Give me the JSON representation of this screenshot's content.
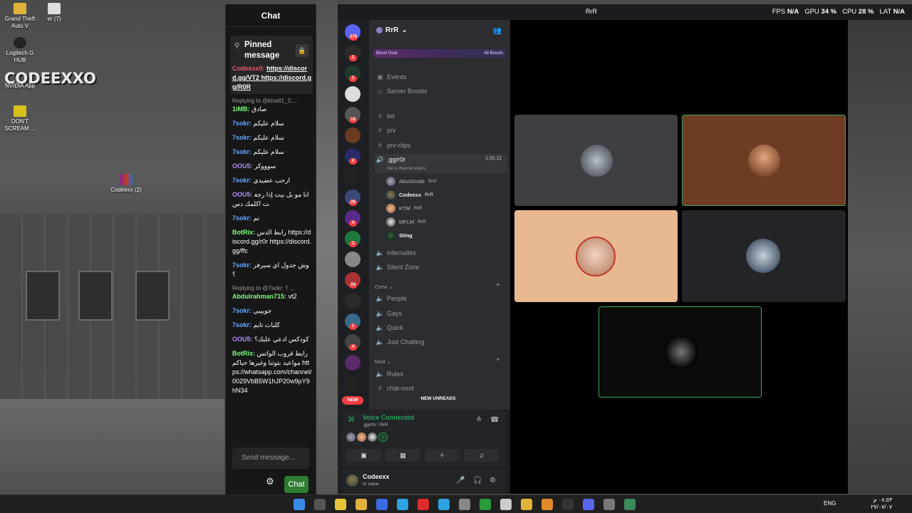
{
  "desktop": {
    "icons": [
      {
        "label": "Grand Theft Auto V"
      },
      {
        "label": "er (7)"
      },
      {
        "label": "Logitech G HUB"
      },
      {
        "label": "NVIDIA App"
      },
      {
        "label": "DON'T SCREAM ..."
      },
      {
        "label": "Codeexx (2)"
      }
    ],
    "logo_text": "CODEEXXO"
  },
  "chat": {
    "title": "Chat",
    "pinned_label": "Pinned message",
    "pinned_msgs": [
      {
        "user": "Codeexx0:",
        "text": "https://discord.gg/VT2 https://discord.gg/R0R"
      }
    ],
    "messages": [
      {
        "user": "Codeexx0:",
        "text": "https://discord.gg/VT2 https://discord.gg/R0R",
        "color": "red",
        "link": true
      },
      {
        "reply": "Replying to @khalil1_2:...",
        "user": "1iMB:",
        "text": "صادق",
        "color": "green"
      },
      {
        "user": "7sokr:",
        "text": "سلام عليكم",
        "color": "blue"
      },
      {
        "user": "7sokr:",
        "text": "سلام عليكم",
        "color": "blue"
      },
      {
        "user": "7sokr:",
        "text": "سلام عليكم",
        "color": "blue"
      },
      {
        "user": "OOU5:",
        "text": "سوووكر",
        "color": "purple"
      },
      {
        "user": "7sokr:",
        "text": "ارحب عضيدي",
        "color": "blue"
      },
      {
        "user": "OOU5:",
        "text": "انا مو بل بيت إذا رجعت اكلمك دس",
        "color": "purple"
      },
      {
        "user": "7sokr:",
        "text": "تم",
        "color": "blue"
      },
      {
        "user": "BotRix:",
        "text": "رابط الدس https://discord.gg/r0r https://discord.gg/ffc",
        "color": "green"
      },
      {
        "user": "7sokr:",
        "text": "وش جدول اي سيرفر ؟",
        "color": "blue"
      },
      {
        "reply": "Replying to @7sokr: ؟ ...",
        "user": "Abdulrahman715:",
        "text": "vt2",
        "color": "green"
      },
      {
        "user": "7sokr:",
        "text": "جويييي",
        "color": "blue"
      },
      {
        "user": "7sokr:",
        "text": "كلبات تايم",
        "color": "blue"
      },
      {
        "user": "OOU5:",
        "text": "كودكس ادعي عليك؟",
        "color": "purple"
      },
      {
        "user": "BotRix:",
        "text": "رابط قروب الواتس مواعيد بثوثنا وغيرها حياكم https://whatsapp.com/channel/0029VbB5W1hJP20w9pY9hN34",
        "color": "green"
      }
    ],
    "input_placeholder": "Send message...",
    "send_label": "Chat"
  },
  "overlay": {
    "fps_label": "FPS",
    "fps_value": "N/A",
    "gpu_label": "GPU",
    "gpu_value": "34 %",
    "cpu_label": "CPU",
    "cpu_value": "28 %",
    "lat_label": "LAT",
    "lat_value": "N/A"
  },
  "discord": {
    "window_title": "RrR",
    "server_badges": [
      "278",
      "1",
      "1",
      "14",
      "2",
      "29",
      "4",
      "3",
      "24",
      "1",
      "4"
    ],
    "new_pill": "NEW",
    "guild_name": "RrR",
    "boost_goal": "Boost Goal",
    "boost_count": "48 Boosts",
    "top_items": [
      {
        "label": "Events",
        "icon": "calendar-icon"
      },
      {
        "label": "Server Boosts",
        "icon": "boost-icon"
      }
    ],
    "channels": [
      {
        "label": "list",
        "icon": "#"
      },
      {
        "label": "prv",
        "icon": "#"
      },
      {
        "label": "prv-clips",
        "icon": "#"
      }
    ],
    "active_voice": {
      "label": ".gg/r0r",
      "time": "1:31:11",
      "status": "Set a channel status"
    },
    "voice_users": [
      {
        "name": "AbuGhraib",
        "tag": "SnV"
      },
      {
        "name": "Codeexx",
        "tag": "RrR"
      },
      {
        "name": "KTM",
        "tag": "RrR"
      },
      {
        "name": "MFLM",
        "tag": "RrR"
      },
      {
        "name": "Sting",
        "tag": ""
      }
    ],
    "voice_channels": [
      {
        "label": "infernalles"
      },
      {
        "label": "Silent Zone"
      }
    ],
    "category_crew": "Crew",
    "crew_channels": [
      {
        "label": "People"
      },
      {
        "label": "Gays"
      },
      {
        "label": "Quick"
      },
      {
        "label": "Just Chatting"
      }
    ],
    "category_mod": "Mod",
    "mod_channels": [
      {
        "label": "Rules",
        "icon": "speaker"
      },
      {
        "label": "chat-mod",
        "icon": "#"
      }
    ],
    "new_unreads": "NEW UNREADS",
    "voice_panel": {
      "status": "Voice Connected",
      "sub": ".gg/r0r / RrR"
    },
    "user": {
      "name": "Codeexx",
      "status": "In voice"
    }
  },
  "taskbar": {
    "lang": "ENG",
    "time": "٠٨:٥٣ م",
    "date": "٢٧/٠٧/٠٧"
  },
  "colors": {
    "discord_bg": "#1e1f22",
    "channel_bg": "#2b2d31",
    "voice_green": "#23a55a",
    "badge_red": "#f23f43",
    "speaking_border": "#3ba55d"
  }
}
